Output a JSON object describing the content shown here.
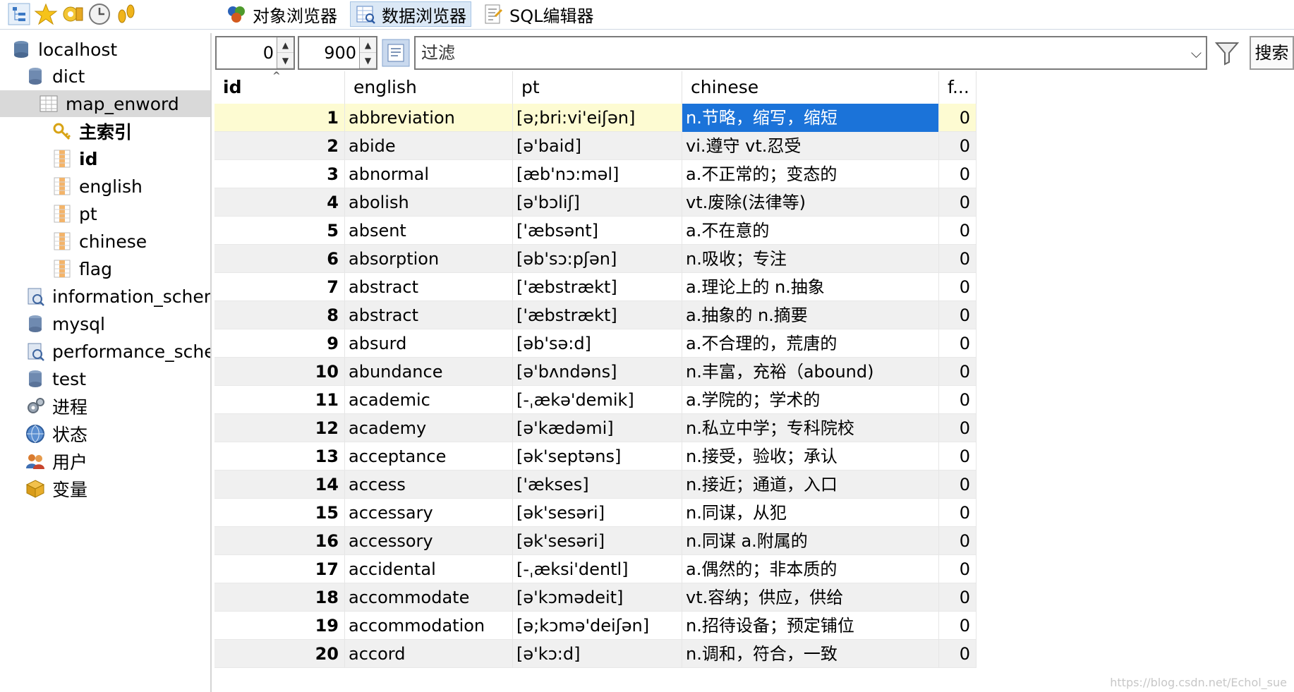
{
  "toolbar": {
    "tabs": [
      {
        "label": "对象浏览器",
        "icon": "object-browser-icon"
      },
      {
        "label": "数据浏览器",
        "icon": "data-browser-icon"
      },
      {
        "label": "SQL编辑器",
        "icon": "sql-editor-icon"
      }
    ]
  },
  "tree": {
    "server": "localhost",
    "db": "dict",
    "table": "map_enword",
    "index": "主索引",
    "columns": [
      "id",
      "english",
      "pt",
      "chinese",
      "flag"
    ],
    "other_dbs": [
      "information_schem",
      "mysql",
      "performance_scher",
      "test"
    ],
    "extras": [
      "进程",
      "状态",
      "用户",
      "变量"
    ]
  },
  "filterbar": {
    "offset": "0",
    "limit": "900",
    "filter_placeholder": "过滤",
    "search_label": "搜索"
  },
  "grid": {
    "headers": [
      "id",
      "english",
      "pt",
      "chinese",
      "f..."
    ],
    "rows": [
      {
        "id": "1",
        "english": "abbreviation",
        "pt": "[ə;bri:vi'eiʃən]",
        "chinese": "n.节略，缩写，缩短",
        "flag": "0"
      },
      {
        "id": "2",
        "english": "abide",
        "pt": "[ə'baid]",
        "chinese": "vi.遵守 vt.忍受",
        "flag": "0"
      },
      {
        "id": "3",
        "english": "abnormal",
        "pt": "[æb'nɔ:məl]",
        "chinese": "a.不正常的；变态的",
        "flag": "0"
      },
      {
        "id": "4",
        "english": "abolish",
        "pt": "[ə'bɔliʃ]",
        "chinese": "vt.废除(法律等)",
        "flag": "0"
      },
      {
        "id": "5",
        "english": "absent",
        "pt": "['æbsənt]",
        "chinese": "a.不在意的",
        "flag": "0"
      },
      {
        "id": "6",
        "english": "absorption",
        "pt": "[əb'sɔ:pʃən]",
        "chinese": "n.吸收；专注",
        "flag": "0"
      },
      {
        "id": "7",
        "english": "abstract",
        "pt": "['æbstrækt]",
        "chinese": "a.理论上的 n.抽象",
        "flag": "0"
      },
      {
        "id": "8",
        "english": "abstract",
        "pt": "['æbstrækt]",
        "chinese": "a.抽象的 n.摘要",
        "flag": "0"
      },
      {
        "id": "9",
        "english": "absurd",
        "pt": "[əb'sə:d]",
        "chinese": "a.不合理的，荒唐的",
        "flag": "0"
      },
      {
        "id": "10",
        "english": "abundance",
        "pt": "[ə'bʌndəns]",
        "chinese": "n.丰富，充裕（abound)",
        "flag": "0"
      },
      {
        "id": "11",
        "english": "academic",
        "pt": "[-ˌækə'demik]",
        "chinese": "a.学院的；学术的",
        "flag": "0"
      },
      {
        "id": "12",
        "english": "academy",
        "pt": "[ə'kædəmi]",
        "chinese": "n.私立中学；专科院校",
        "flag": "0"
      },
      {
        "id": "13",
        "english": "acceptance",
        "pt": "[ək'septəns]",
        "chinese": "n.接受，验收；承认",
        "flag": "0"
      },
      {
        "id": "14",
        "english": "access",
        "pt": "['ækses]",
        "chinese": "n.接近；通道，入口",
        "flag": "0"
      },
      {
        "id": "15",
        "english": "accessary",
        "pt": "[ək'sesəri]",
        "chinese": "n.同谋，从犯",
        "flag": "0"
      },
      {
        "id": "16",
        "english": "accessory",
        "pt": "[ək'sesəri]",
        "chinese": "n.同谋 a.附属的",
        "flag": "0"
      },
      {
        "id": "17",
        "english": "accidental",
        "pt": "[-ˌæksi'dentl]",
        "chinese": "a.偶然的；非本质的",
        "flag": "0"
      },
      {
        "id": "18",
        "english": "accommodate",
        "pt": "[ə'kɔmədeit]",
        "chinese": "vt.容纳；供应，供给",
        "flag": "0"
      },
      {
        "id": "19",
        "english": "accommodation",
        "pt": "[ə;kɔmə'deiʃən]",
        "chinese": "n.招待设备；预定铺位",
        "flag": "0"
      },
      {
        "id": "20",
        "english": "accord",
        "pt": "[ə'kɔ:d]",
        "chinese": "n.调和，符合，一致",
        "flag": "0"
      }
    ]
  },
  "watermark": "https://blog.csdn.net/Echol_sue",
  "colors": {
    "selection": "#1b73d9",
    "current_row": "#fdfbd2",
    "alt_row": "#f0f0f0"
  }
}
